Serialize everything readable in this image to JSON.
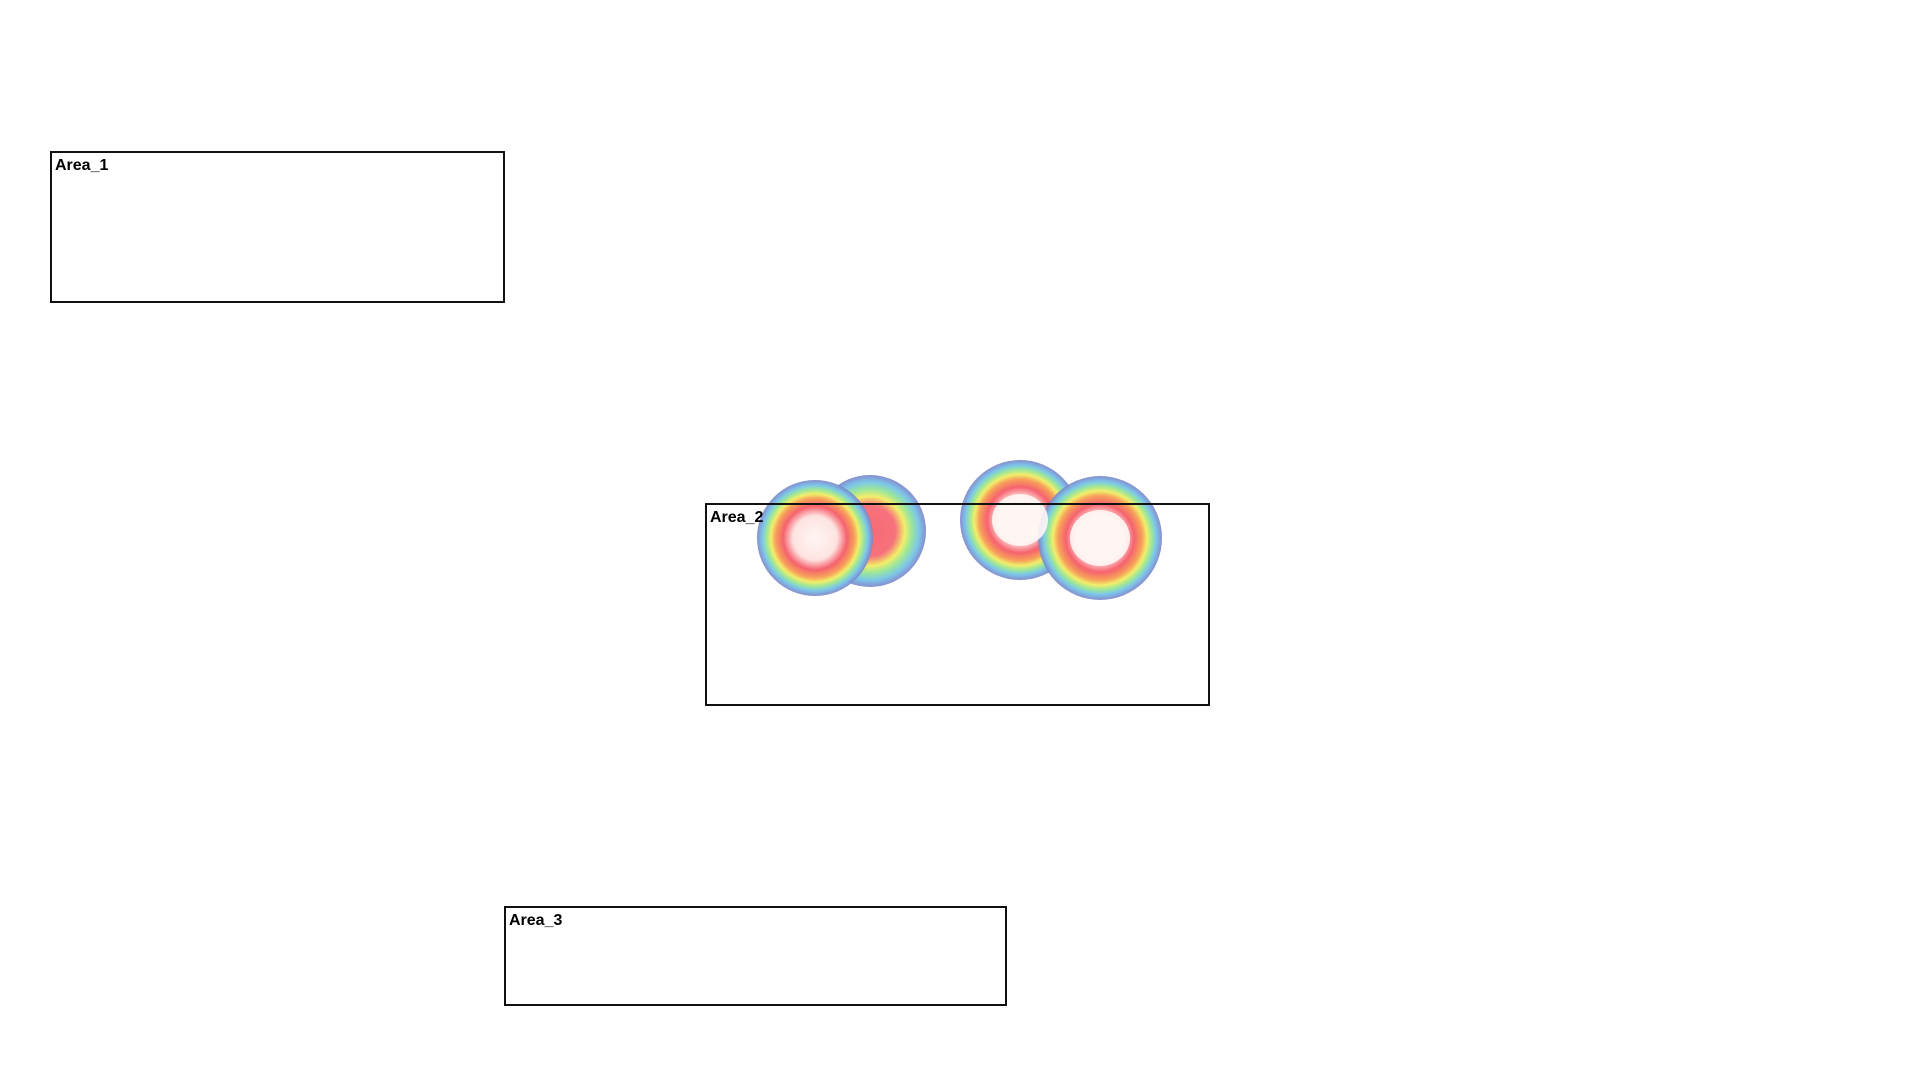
{
  "areas": [
    {
      "label": "Area_1"
    },
    {
      "label": "Area_2"
    },
    {
      "label": "Area_3"
    }
  ],
  "heatmap": {
    "description_colors": {
      "outer": "#7a83c9",
      "mid_blue": "#78c8e8",
      "yellow": "#f2ee6a",
      "red": "#f6626e",
      "core": "#fff4f2"
    }
  }
}
